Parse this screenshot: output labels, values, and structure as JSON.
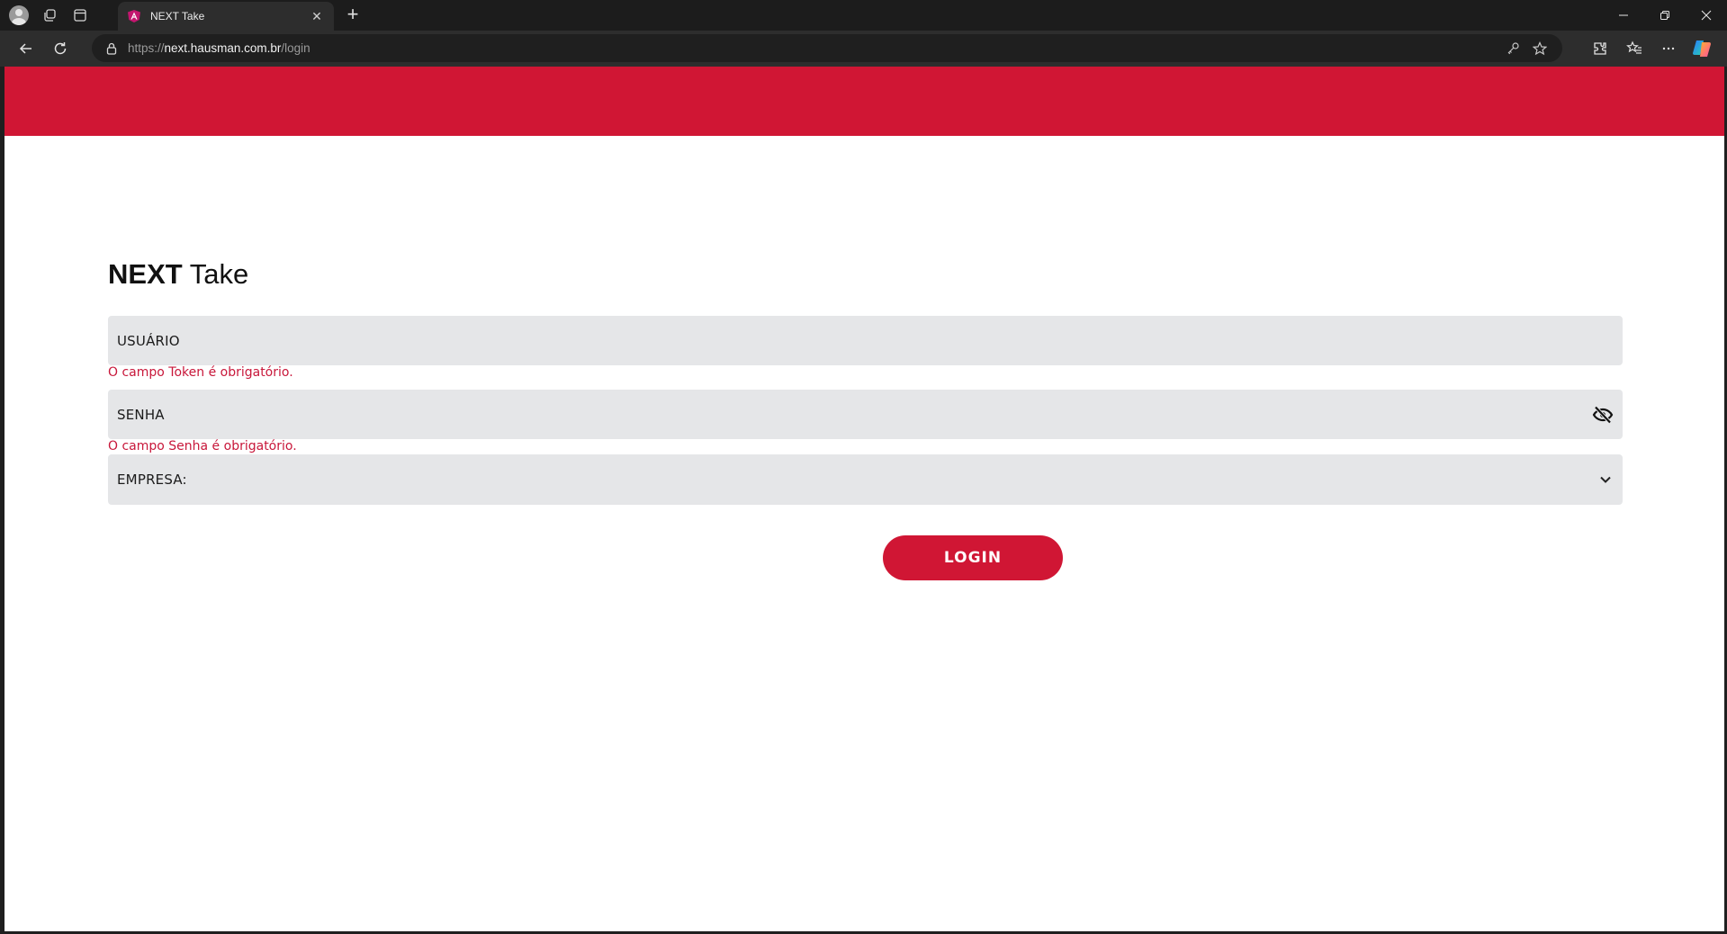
{
  "browser": {
    "tab": {
      "title": "NEXT Take",
      "icon": "angular-favicon-icon"
    },
    "address": {
      "scheme": "https://",
      "host": "next.hausman.com.br",
      "path": "/login"
    }
  },
  "page": {
    "brand": {
      "bold": "NEXT",
      "light": " Take"
    },
    "user_field": {
      "label": "USUÁRIO",
      "error": "O campo Token é obrigatório."
    },
    "password_field": {
      "label": "SENHA",
      "error": "O campo Senha é obrigatório."
    },
    "company_field": {
      "label": "EMPRESA:"
    },
    "login_button": {
      "label": "LOGIN"
    }
  },
  "colors": {
    "brand_red": "#d01634",
    "error_red": "#c8173a",
    "field_bg": "#e5e6e8"
  }
}
